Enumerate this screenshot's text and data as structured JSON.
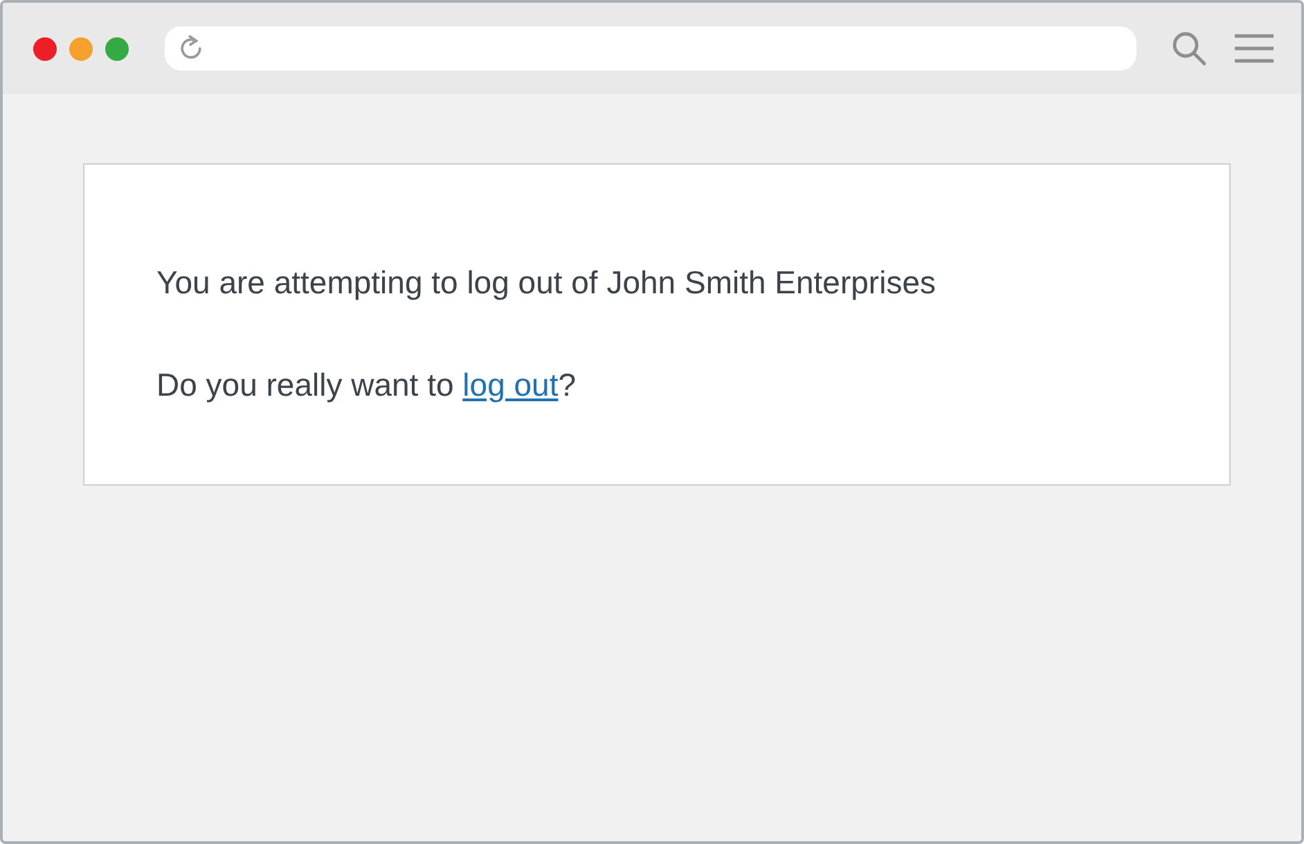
{
  "message": {
    "text": "You are attempting to log out of John Smith Enterprises"
  },
  "question": {
    "before": "Do you really want to ",
    "link": "log out",
    "after": "?"
  }
}
